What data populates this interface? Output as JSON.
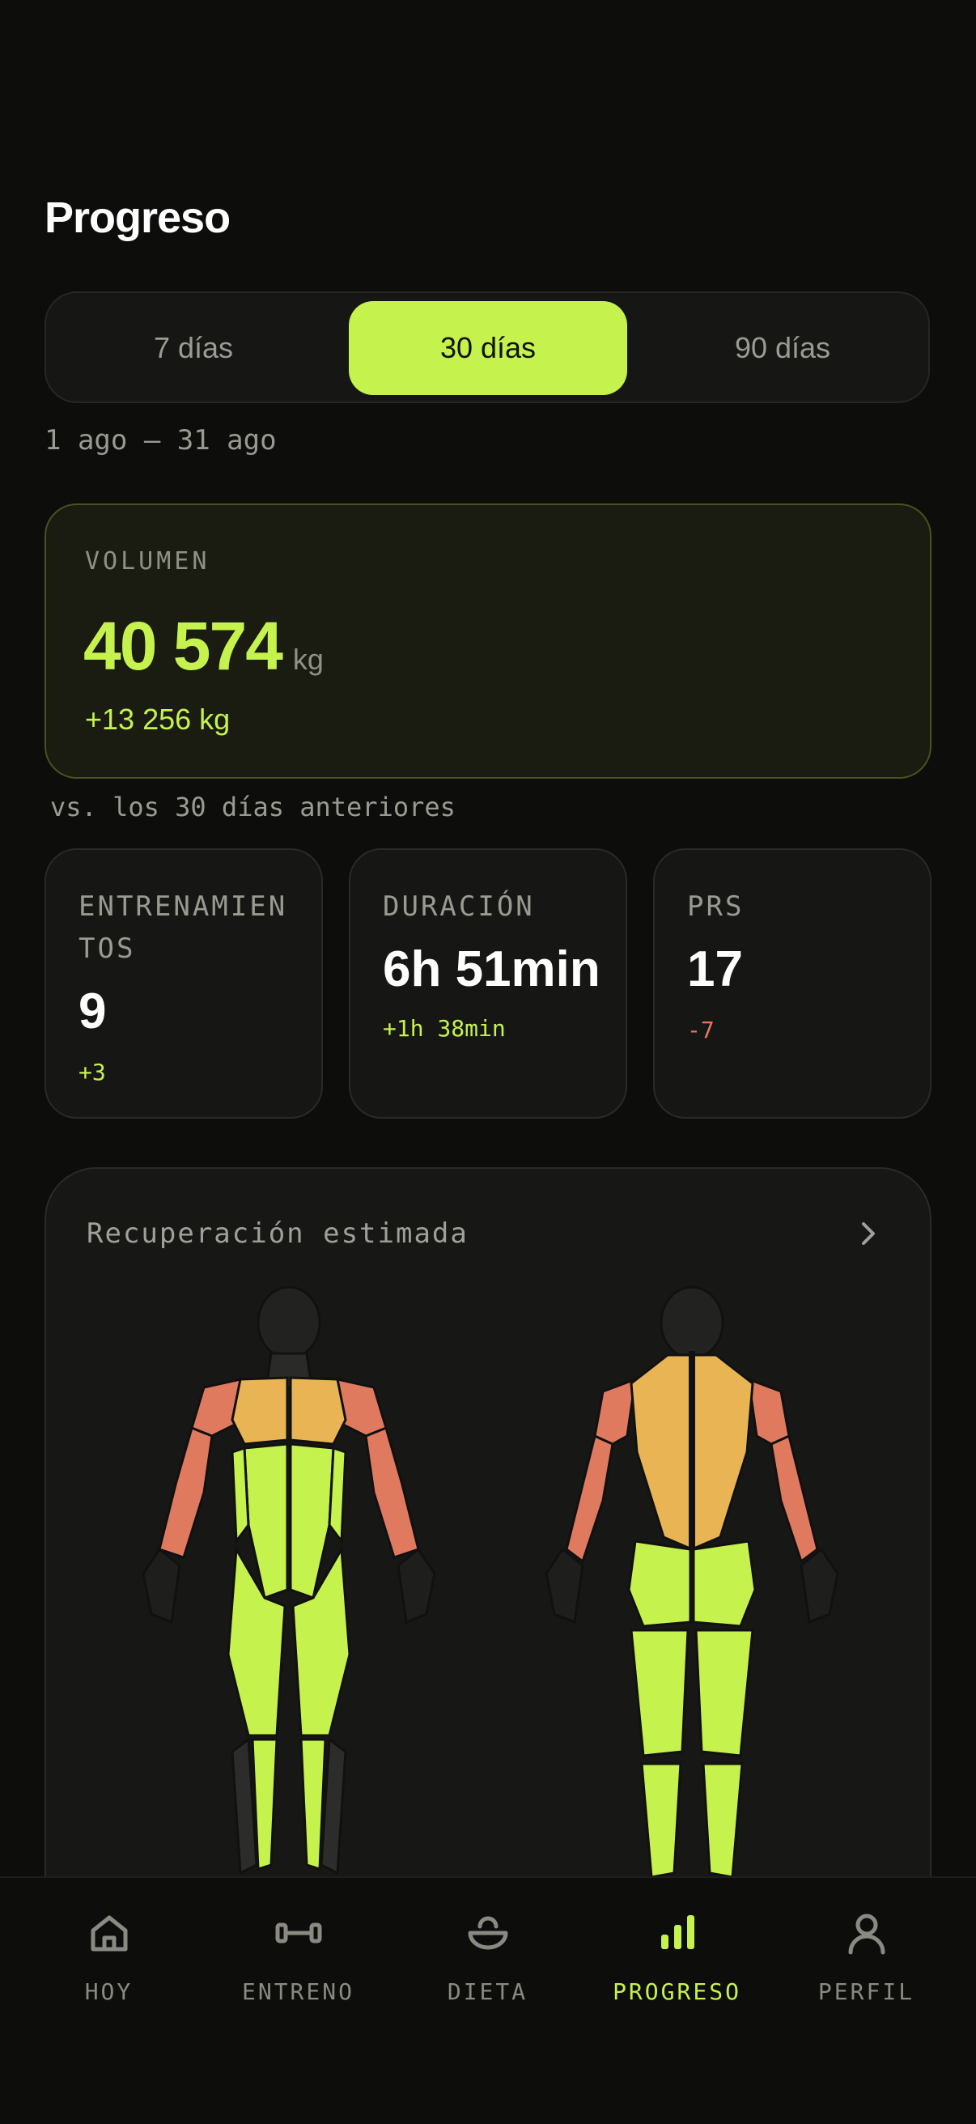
{
  "page": {
    "title": "Progreso"
  },
  "range_selector": {
    "options": [
      "7 días",
      "30 días",
      "90 días"
    ],
    "selected": "30 días",
    "date_range": "1 ago – 31 ago"
  },
  "volume": {
    "label": "VOLUMEN",
    "value": "40 574",
    "unit": "kg",
    "delta": "+13 256 kg",
    "comparison": "vs. los 30 días anteriores"
  },
  "stats": [
    {
      "label": "ENTRENAMIENTOS",
      "value": "9",
      "delta": "+3",
      "delta_color": "#c6f24e"
    },
    {
      "label": "DURACIÓN",
      "value": "6h 51min",
      "delta": "+1h 38min",
      "delta_color": "#c6f24e"
    },
    {
      "label": "PRS",
      "value": "17",
      "delta": "-7",
      "delta_color": "#e07a5f"
    }
  ],
  "recovery": {
    "title": "Recuperación estimada",
    "legend_colors": {
      "recovered": "#c6f24e",
      "partial": "#e8b454",
      "fatigued": "#e07a5f",
      "inactive": "#2c2c2a"
    }
  },
  "nav": {
    "items": [
      {
        "label": "HOY",
        "icon": "home-icon"
      },
      {
        "label": "ENTRENO",
        "icon": "dumbbell-icon"
      },
      {
        "label": "DIETA",
        "icon": "bowl-icon"
      },
      {
        "label": "PROGRESO",
        "icon": "bar-chart-icon"
      },
      {
        "label": "PERFIL",
        "icon": "user-icon"
      }
    ],
    "active": "PROGRESO"
  },
  "colors": {
    "accent": "#c6f24e",
    "background": "#0d0d0c",
    "negative": "#e07a5f"
  }
}
